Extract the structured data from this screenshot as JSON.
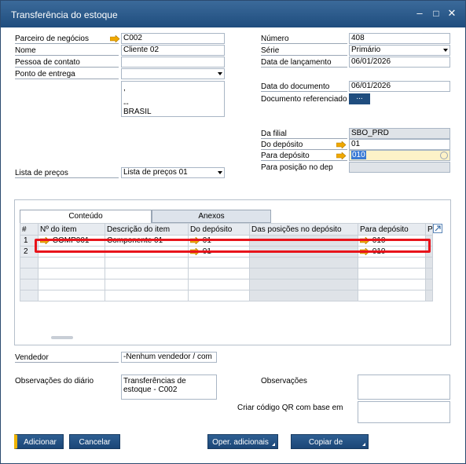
{
  "window": {
    "title": "Transferência do estoque",
    "controls": {
      "minimize": "–",
      "maximize": "□",
      "close": "✕"
    }
  },
  "left_form": {
    "business_partner": {
      "label": "Parceiro de negócios",
      "value": "C002"
    },
    "name": {
      "label": "Nome",
      "value": "Cliente 02"
    },
    "contact": {
      "label": "Pessoa de contato",
      "value": ""
    },
    "ship_to": {
      "label": "Ponto de entrega",
      "value": ""
    },
    "address_lines": [
      ",",
      "",
      "--",
      "BRASIL"
    ],
    "price_list": {
      "label": "Lista de preços",
      "value": "Lista de preços 01"
    }
  },
  "right_form": {
    "number": {
      "label": "Número",
      "value": "408"
    },
    "series": {
      "label": "Série",
      "value": "Primário"
    },
    "posting_date": {
      "label": "Data de lançamento",
      "value": "06/01/2026"
    },
    "document_date": {
      "label": "Data do documento",
      "value": "06/01/2026"
    },
    "ref_doc": {
      "label": "Documento referenciado",
      "button": "..."
    },
    "from_branch": {
      "label": "Da filial",
      "value": "SBO_PRD"
    },
    "from_warehouse": {
      "label": "Do depósito",
      "value": "01"
    },
    "to_warehouse": {
      "label": "Para depósito",
      "value": "010"
    },
    "to_bin": {
      "label": "Para posição no dep",
      "value": ""
    }
  },
  "tabs": [
    {
      "label": "Conteúdo",
      "active": true
    },
    {
      "label": "Anexos",
      "active": false
    }
  ],
  "grid": {
    "headers": [
      "#",
      "Nº do item",
      "Descrição do item",
      "Do depósito",
      "Das posições no depósito",
      "Para depósito",
      "P"
    ],
    "rows": [
      {
        "num": "1",
        "item": "COMP001",
        "desc": "Componente 01",
        "from": "01",
        "bins": "",
        "to": "010"
      },
      {
        "num": "2",
        "item": "",
        "desc": "",
        "from": "01",
        "bins": "",
        "to": "010"
      }
    ]
  },
  "bottom_form": {
    "salesperson": {
      "label": "Vendedor",
      "value": "-Nenhum vendedor / com"
    },
    "journal_remarks": {
      "label": "Observações do diário",
      "value": "Transferências de estoque - C002"
    },
    "remarks": {
      "label": "Observações",
      "value": ""
    },
    "qr_code": {
      "label": "Criar código QR com base em",
      "value": ""
    }
  },
  "buttons": {
    "add": "Adicionar",
    "cancel": "Cancelar",
    "more": "Oper. adicionais",
    "copy_from": "Copiar de"
  },
  "colors": {
    "titlebar": "#1f4d7e",
    "button": "#1f4d7e",
    "highlight_box": "#e8141b",
    "link_arrow": "#f0a800"
  }
}
